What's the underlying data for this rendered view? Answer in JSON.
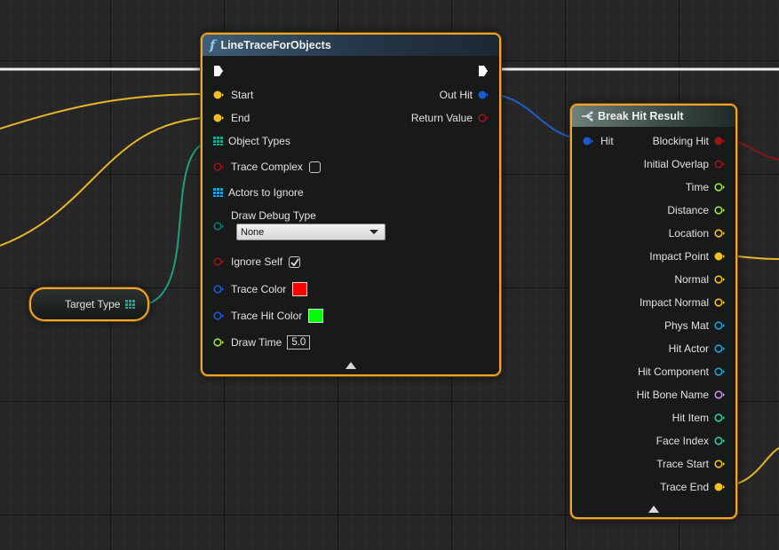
{
  "trace_node": {
    "title": "LineTraceForObjects",
    "function_glyph": "f",
    "inputs": {
      "start": "Start",
      "end": "End",
      "object_types": "Object Types",
      "trace_complex": "Trace Complex",
      "actors_to_ignore": "Actors to Ignore",
      "draw_debug_type": "Draw Debug Type",
      "draw_debug_value": "None",
      "ignore_self": "Ignore Self",
      "trace_color": "Trace Color",
      "trace_hit_color": "Trace Hit Color",
      "draw_time": "Draw Time",
      "draw_time_value": "5.0"
    },
    "outputs": {
      "out_hit": "Out Hit",
      "return_value": "Return Value"
    },
    "trace_complex_checked": false,
    "ignore_self_checked": true,
    "trace_color_hex": "#ff0000",
    "trace_hit_color_hex": "#00ff00"
  },
  "target_node": {
    "label": "Target Type"
  },
  "break_node": {
    "title": "Break Hit Result",
    "input": "Hit",
    "outputs": [
      "Blocking Hit",
      "Initial Overlap",
      "Time",
      "Distance",
      "Location",
      "Impact Point",
      "Normal",
      "Impact Normal",
      "Phys Mat",
      "Hit Actor",
      "Hit Component",
      "Hit Bone Name",
      "Hit Item",
      "Face Index",
      "Trace Start",
      "Trace End"
    ]
  },
  "colors": {
    "vector": "#f2c021",
    "bool": "#9a1515",
    "struct": "#1a5ccf",
    "float": "#9be245",
    "object": "#16a4d8",
    "name": "#c890e8",
    "int": "#2ec9a6",
    "byte": "#0f7a6b",
    "node_border": "#f2a526",
    "exec": "#ffffff"
  }
}
